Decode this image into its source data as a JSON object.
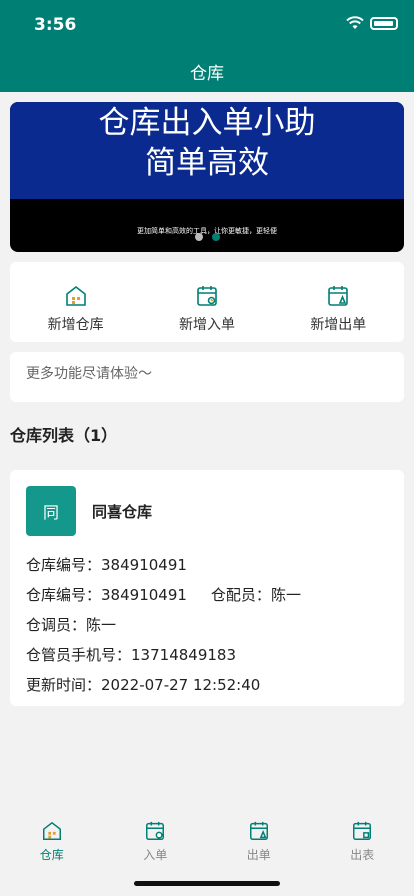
{
  "status_bar": {
    "time": "3:56"
  },
  "header": {
    "title": "仓库"
  },
  "banner": {
    "line1": "仓库出入单小助",
    "line2": "简单高效",
    "subtitle": "更加简单和高效的工具，让你更敏捷，更轻便"
  },
  "quick_actions": [
    {
      "label": "新增仓库",
      "icon": "warehouse-icon"
    },
    {
      "label": "新增入单",
      "icon": "calendar-in-icon"
    },
    {
      "label": "新增出单",
      "icon": "calendar-out-icon"
    }
  ],
  "notice": "更多功能尽请体验～",
  "list": {
    "title": "仓库列表（1）",
    "items": [
      {
        "avatar": "同",
        "name": "同喜仓库",
        "label_code": "仓库编号：",
        "code": "384910491",
        "label_code2": "仓库编号：",
        "code2": "384910491",
        "label_distributor": "仓配员：",
        "distributor": "陈一",
        "label_dispatcher": "仓调员：",
        "dispatcher": "陈一",
        "label_phone": "仓管员手机号：",
        "phone": "13714849183",
        "label_updated": "更新时间：",
        "updated": "2022-07-27 12:52:40"
      }
    ]
  },
  "tabs": [
    {
      "label": "仓库",
      "active": true
    },
    {
      "label": "入单",
      "active": false
    },
    {
      "label": "出单",
      "active": false
    },
    {
      "label": "出表",
      "active": false
    }
  ],
  "colors": {
    "primary": "#007f74",
    "banner": "#0a2a8f",
    "avatar": "#15988c"
  }
}
